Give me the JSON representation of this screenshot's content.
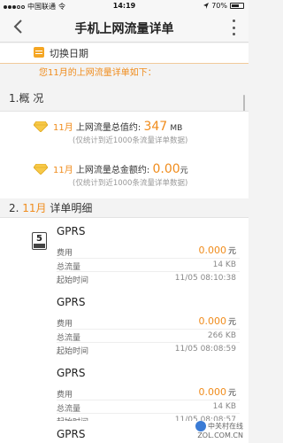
{
  "status_bar": {
    "carrier": "中国联通",
    "network": "令",
    "time": "14:19",
    "battery_percent": "70%",
    "battery_level": 0.7
  },
  "nav": {
    "title": "手机上网流量详单",
    "back_icon": "chevron-left-icon",
    "more_icon": "more-vertical-icon"
  },
  "date_switch": {
    "label": "切换日期",
    "icon": "calendar-icon"
  },
  "notice": "您11月的上网流量详单如下：",
  "overview": {
    "title": "1.概 况",
    "usage": {
      "month": "11月",
      "label": "上网流量总值约:",
      "value": "347",
      "unit": "MB",
      "note": "(仅统计到近1000条流量详单数据)"
    },
    "cost": {
      "month": "11月",
      "label": "上网流量总金额约:",
      "value": "0.00",
      "unit": "元",
      "note": "(仅统计到近1000条流量详单数据)"
    }
  },
  "details": {
    "title_prefix": "2.",
    "title_month": "11月",
    "title_suffix": "详单明细",
    "sim_icon_number": "5",
    "labels": {
      "fee": "费用",
      "total": "总流量",
      "start": "起始时间",
      "currency": "元"
    },
    "items": [
      {
        "name": "GPRS",
        "fee": "0.000",
        "total": "14 KB",
        "start": "11/05 08:10:38"
      },
      {
        "name": "GPRS",
        "fee": "0.000",
        "total": "266 KB",
        "start": "11/05 08:08:59"
      },
      {
        "name": "GPRS",
        "fee": "0.000",
        "total": "14 KB",
        "start": "11/05 08:08:57"
      },
      {
        "name": "GPRS"
      }
    ]
  },
  "watermark": {
    "line1": "中关村在线",
    "line2": "ZOL.COM.CN"
  },
  "colors": {
    "accent": "#f08c1c",
    "calendar": "#f5a623",
    "diamond": "#f7c948"
  }
}
